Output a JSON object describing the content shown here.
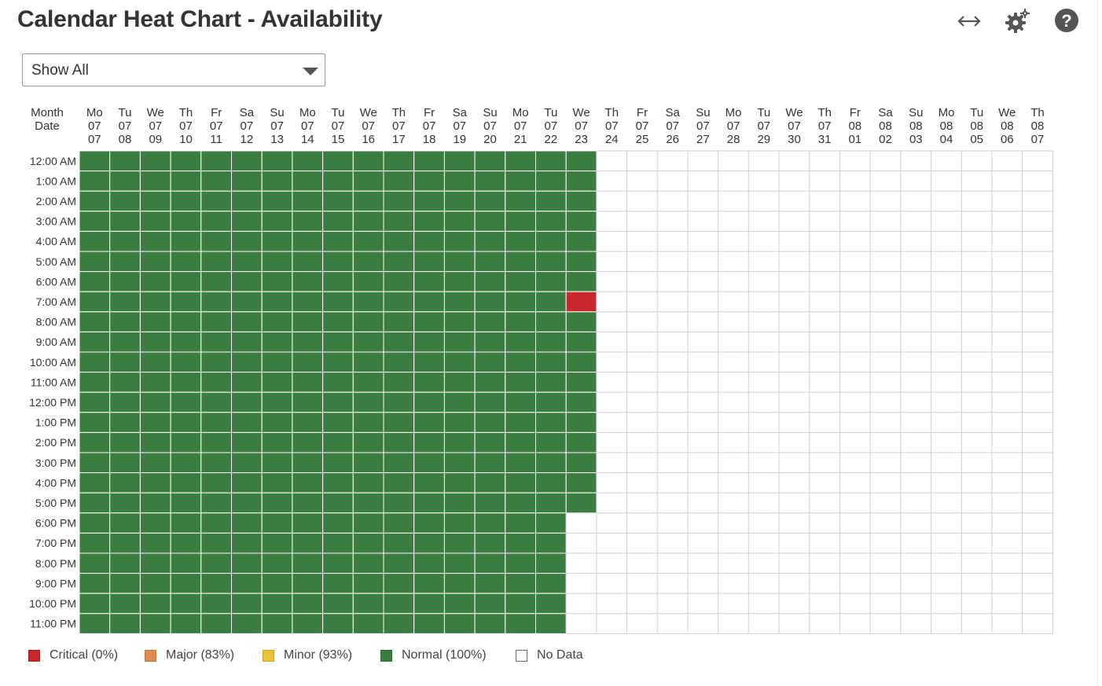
{
  "header": {
    "title": "Calendar Heat Chart - Availability",
    "icons": [
      "expand-horizontal-icon",
      "gear-icon",
      "help-icon"
    ]
  },
  "filter": {
    "selected": "Show All"
  },
  "colors": {
    "critical": "#c8282d",
    "major": "#e08a4e",
    "minor": "#ebc23a",
    "normal": "#3b7d40",
    "no_data": "#ffffff",
    "grid": "#cfd4da"
  },
  "chart_data": {
    "type": "heatmap",
    "corner_label": [
      "Month",
      "Date"
    ],
    "columns": [
      {
        "weekday": "Mo",
        "month": "07",
        "day": "07"
      },
      {
        "weekday": "Tu",
        "month": "07",
        "day": "08"
      },
      {
        "weekday": "We",
        "month": "07",
        "day": "09"
      },
      {
        "weekday": "Th",
        "month": "07",
        "day": "10"
      },
      {
        "weekday": "Fr",
        "month": "07",
        "day": "11"
      },
      {
        "weekday": "Sa",
        "month": "07",
        "day": "12"
      },
      {
        "weekday": "Su",
        "month": "07",
        "day": "13"
      },
      {
        "weekday": "Mo",
        "month": "07",
        "day": "14"
      },
      {
        "weekday": "Tu",
        "month": "07",
        "day": "15"
      },
      {
        "weekday": "We",
        "month": "07",
        "day": "16"
      },
      {
        "weekday": "Th",
        "month": "07",
        "day": "17"
      },
      {
        "weekday": "Fr",
        "month": "07",
        "day": "18"
      },
      {
        "weekday": "Sa",
        "month": "07",
        "day": "19"
      },
      {
        "weekday": "Su",
        "month": "07",
        "day": "20"
      },
      {
        "weekday": "Mo",
        "month": "07",
        "day": "21"
      },
      {
        "weekday": "Tu",
        "month": "07",
        "day": "22"
      },
      {
        "weekday": "We",
        "month": "07",
        "day": "23"
      },
      {
        "weekday": "Th",
        "month": "07",
        "day": "24"
      },
      {
        "weekday": "Fr",
        "month": "07",
        "day": "25"
      },
      {
        "weekday": "Sa",
        "month": "07",
        "day": "26"
      },
      {
        "weekday": "Su",
        "month": "07",
        "day": "27"
      },
      {
        "weekday": "Mo",
        "month": "07",
        "day": "28"
      },
      {
        "weekday": "Tu",
        "month": "07",
        "day": "29"
      },
      {
        "weekday": "We",
        "month": "07",
        "day": "30"
      },
      {
        "weekday": "Th",
        "month": "07",
        "day": "31"
      },
      {
        "weekday": "Fr",
        "month": "08",
        "day": "01"
      },
      {
        "weekday": "Sa",
        "month": "08",
        "day": "02"
      },
      {
        "weekday": "Su",
        "month": "08",
        "day": "03"
      },
      {
        "weekday": "Mo",
        "month": "08",
        "day": "04"
      },
      {
        "weekday": "Tu",
        "month": "08",
        "day": "05"
      },
      {
        "weekday": "We",
        "month": "08",
        "day": "06"
      },
      {
        "weekday": "Th",
        "month": "08",
        "day": "07"
      }
    ],
    "rows": [
      "12:00 AM",
      "1:00 AM",
      "2:00 AM",
      "3:00 AM",
      "4:00 AM",
      "5:00 AM",
      "6:00 AM",
      "7:00 AM",
      "8:00 AM",
      "9:00 AM",
      "10:00 AM",
      "11:00 AM",
      "12:00 PM",
      "1:00 PM",
      "2:00 PM",
      "3:00 PM",
      "4:00 PM",
      "5:00 PM",
      "6:00 PM",
      "7:00 PM",
      "8:00 PM",
      "9:00 PM",
      "10:00 PM",
      "11:00 PM"
    ],
    "fill": {
      "default_status": "no_data",
      "ranges": [
        {
          "status": "normal",
          "from_column": 0,
          "to_column": 15,
          "from_row": 0,
          "to_row": 23
        },
        {
          "status": "normal",
          "from_column": 16,
          "to_column": 16,
          "from_row": 0,
          "to_row": 17
        }
      ],
      "overrides": [
        {
          "column": 16,
          "row": 7,
          "status": "critical"
        }
      ]
    }
  },
  "legend": [
    {
      "key": "critical",
      "label": "Critical (0%)"
    },
    {
      "key": "major",
      "label": "Major (83%)"
    },
    {
      "key": "minor",
      "label": "Minor (93%)"
    },
    {
      "key": "normal",
      "label": "Normal (100%)"
    },
    {
      "key": "no_data",
      "label": "No Data"
    }
  ]
}
